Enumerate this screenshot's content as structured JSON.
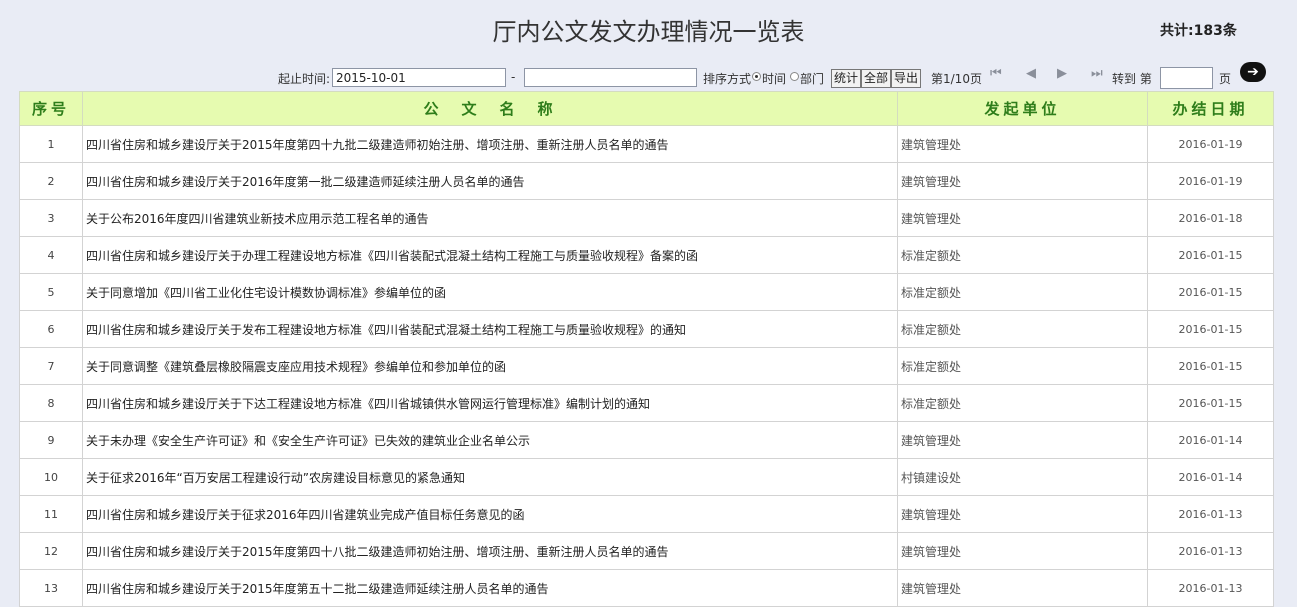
{
  "page": {
    "title": "厅内公文发文办理情况一览表",
    "total": "共计:183条"
  },
  "toolbar": {
    "start_label": "起止时间:",
    "start_value": "2015-10-01",
    "dash": "-",
    "end_value": "",
    "sort_label": "排序方式",
    "sort_time": "时间",
    "sort_dept": "部门",
    "btn_stats": "统计",
    "btn_all": "全部",
    "btn_export": "导出",
    "page_info": "第1/10页",
    "goto_label": "转到 第",
    "goto_value": "",
    "page_unit": "页"
  },
  "table": {
    "headers": {
      "num": "序号",
      "name": "公　文　名　称",
      "dept": "发起单位",
      "date": "办结日期"
    },
    "rows": [
      {
        "num": "1",
        "name": "四川省住房和城乡建设厅关于2015年度第四十九批二级建造师初始注册、增项注册、重新注册人员名单的通告",
        "dept": "建筑管理处",
        "date": "2016-01-19"
      },
      {
        "num": "2",
        "name": "四川省住房和城乡建设厅关于2016年度第一批二级建造师延续注册人员名单的通告",
        "dept": "建筑管理处",
        "date": "2016-01-19"
      },
      {
        "num": "3",
        "name": "关于公布2016年度四川省建筑业新技术应用示范工程名单的通告",
        "dept": "建筑管理处",
        "date": "2016-01-18"
      },
      {
        "num": "4",
        "name": "四川省住房和城乡建设厅关于办理工程建设地方标准《四川省装配式混凝土结构工程施工与质量验收规程》备案的函",
        "dept": "标准定额处",
        "date": "2016-01-15"
      },
      {
        "num": "5",
        "name": "关于同意增加《四川省工业化住宅设计模数协调标准》参编单位的函",
        "dept": "标准定额处",
        "date": "2016-01-15"
      },
      {
        "num": "6",
        "name": "四川省住房和城乡建设厅关于发布工程建设地方标准《四川省装配式混凝土结构工程施工与质量验收规程》的通知",
        "dept": "标准定额处",
        "date": "2016-01-15"
      },
      {
        "num": "7",
        "name": "关于同意调整《建筑叠层橡胶隔震支座应用技术规程》参编单位和参加单位的函",
        "dept": "标准定额处",
        "date": "2016-01-15"
      },
      {
        "num": "8",
        "name": "四川省住房和城乡建设厅关于下达工程建设地方标准《四川省城镇供水管网运行管理标准》编制计划的通知",
        "dept": "标准定额处",
        "date": "2016-01-15"
      },
      {
        "num": "9",
        "name": "关于未办理《安全生产许可证》和《安全生产许可证》已失效的建筑业企业名单公示",
        "dept": "建筑管理处",
        "date": "2016-01-14"
      },
      {
        "num": "10",
        "name": "关于征求2016年“百万安居工程建设行动”农房建设目标意见的紧急通知",
        "dept": "村镇建设处",
        "date": "2016-01-14"
      },
      {
        "num": "11",
        "name": "四川省住房和城乡建设厅关于征求2016年四川省建筑业完成产值目标任务意见的函",
        "dept": "建筑管理处",
        "date": "2016-01-13"
      },
      {
        "num": "12",
        "name": "四川省住房和城乡建设厅关于2015年度第四十八批二级建造师初始注册、增项注册、重新注册人员名单的通告",
        "dept": "建筑管理处",
        "date": "2016-01-13"
      },
      {
        "num": "13",
        "name": "四川省住房和城乡建设厅关于2015年度第五十二批二级建造师延续注册人员名单的通告",
        "dept": "建筑管理处",
        "date": "2016-01-13"
      }
    ]
  },
  "icons": {
    "first": "first-page-icon",
    "prev": "prev-page-icon",
    "next": "next-page-icon",
    "last": "last-page-icon",
    "go": "go-arrow-icon"
  },
  "colors": {
    "background": "#e9ecf5",
    "header_bg": "#e6fbb0",
    "header_text": "#2e7d1a"
  }
}
